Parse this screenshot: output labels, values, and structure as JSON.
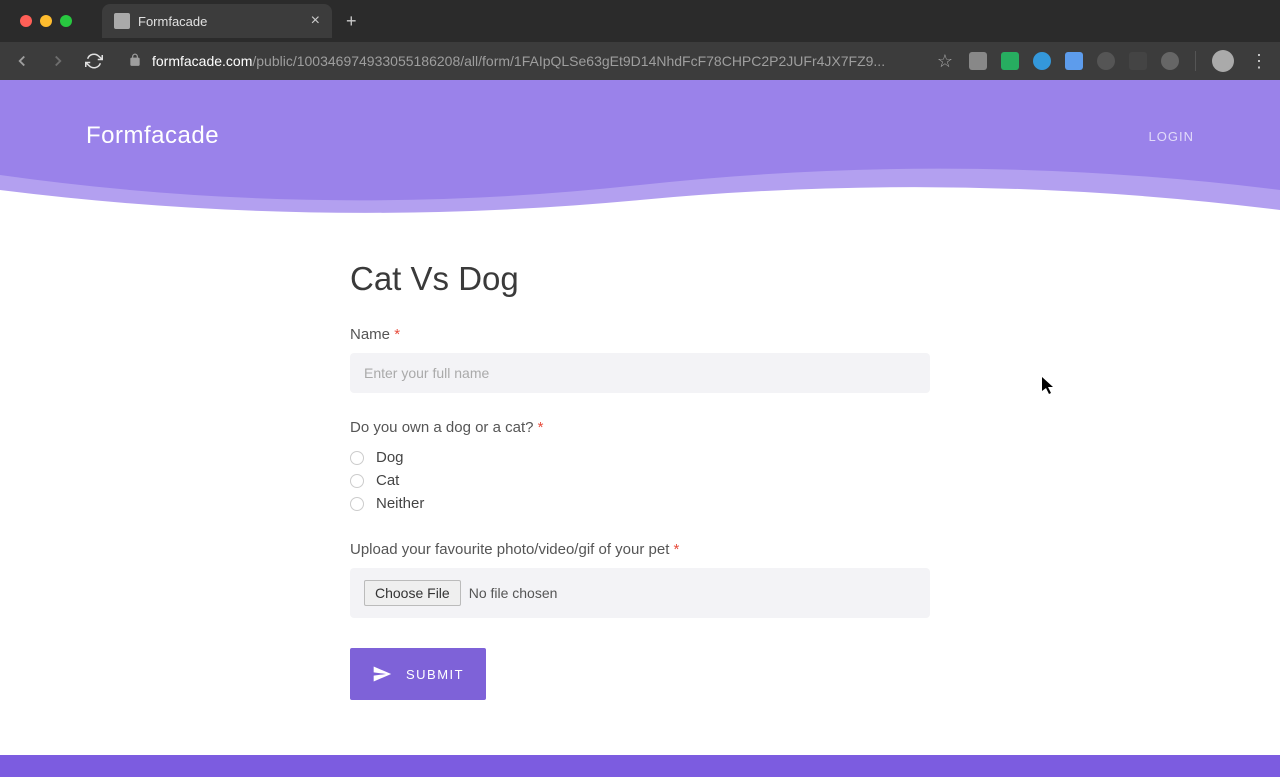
{
  "browser": {
    "tab_title": "Formfacade",
    "url_domain": "formfacade.com",
    "url_path": "/public/100346974933055186208/all/form/1FAIpQLSe63gEt9D14NhdFcF78CHPC2P2JUFr4JX7FZ9..."
  },
  "page": {
    "brand": "Formfacade",
    "login": "LOGIN"
  },
  "form": {
    "title": "Cat Vs Dog",
    "name_label": "Name",
    "name_placeholder": "Enter your full name",
    "pet_question": "Do you own a dog or a cat?",
    "options": {
      "dog": "Dog",
      "cat": "Cat",
      "neither": "Neither"
    },
    "upload_label": "Upload your favourite photo/video/gif of your pet",
    "choose_file": "Choose File",
    "no_file": "No file chosen",
    "submit": "SUBMIT"
  }
}
